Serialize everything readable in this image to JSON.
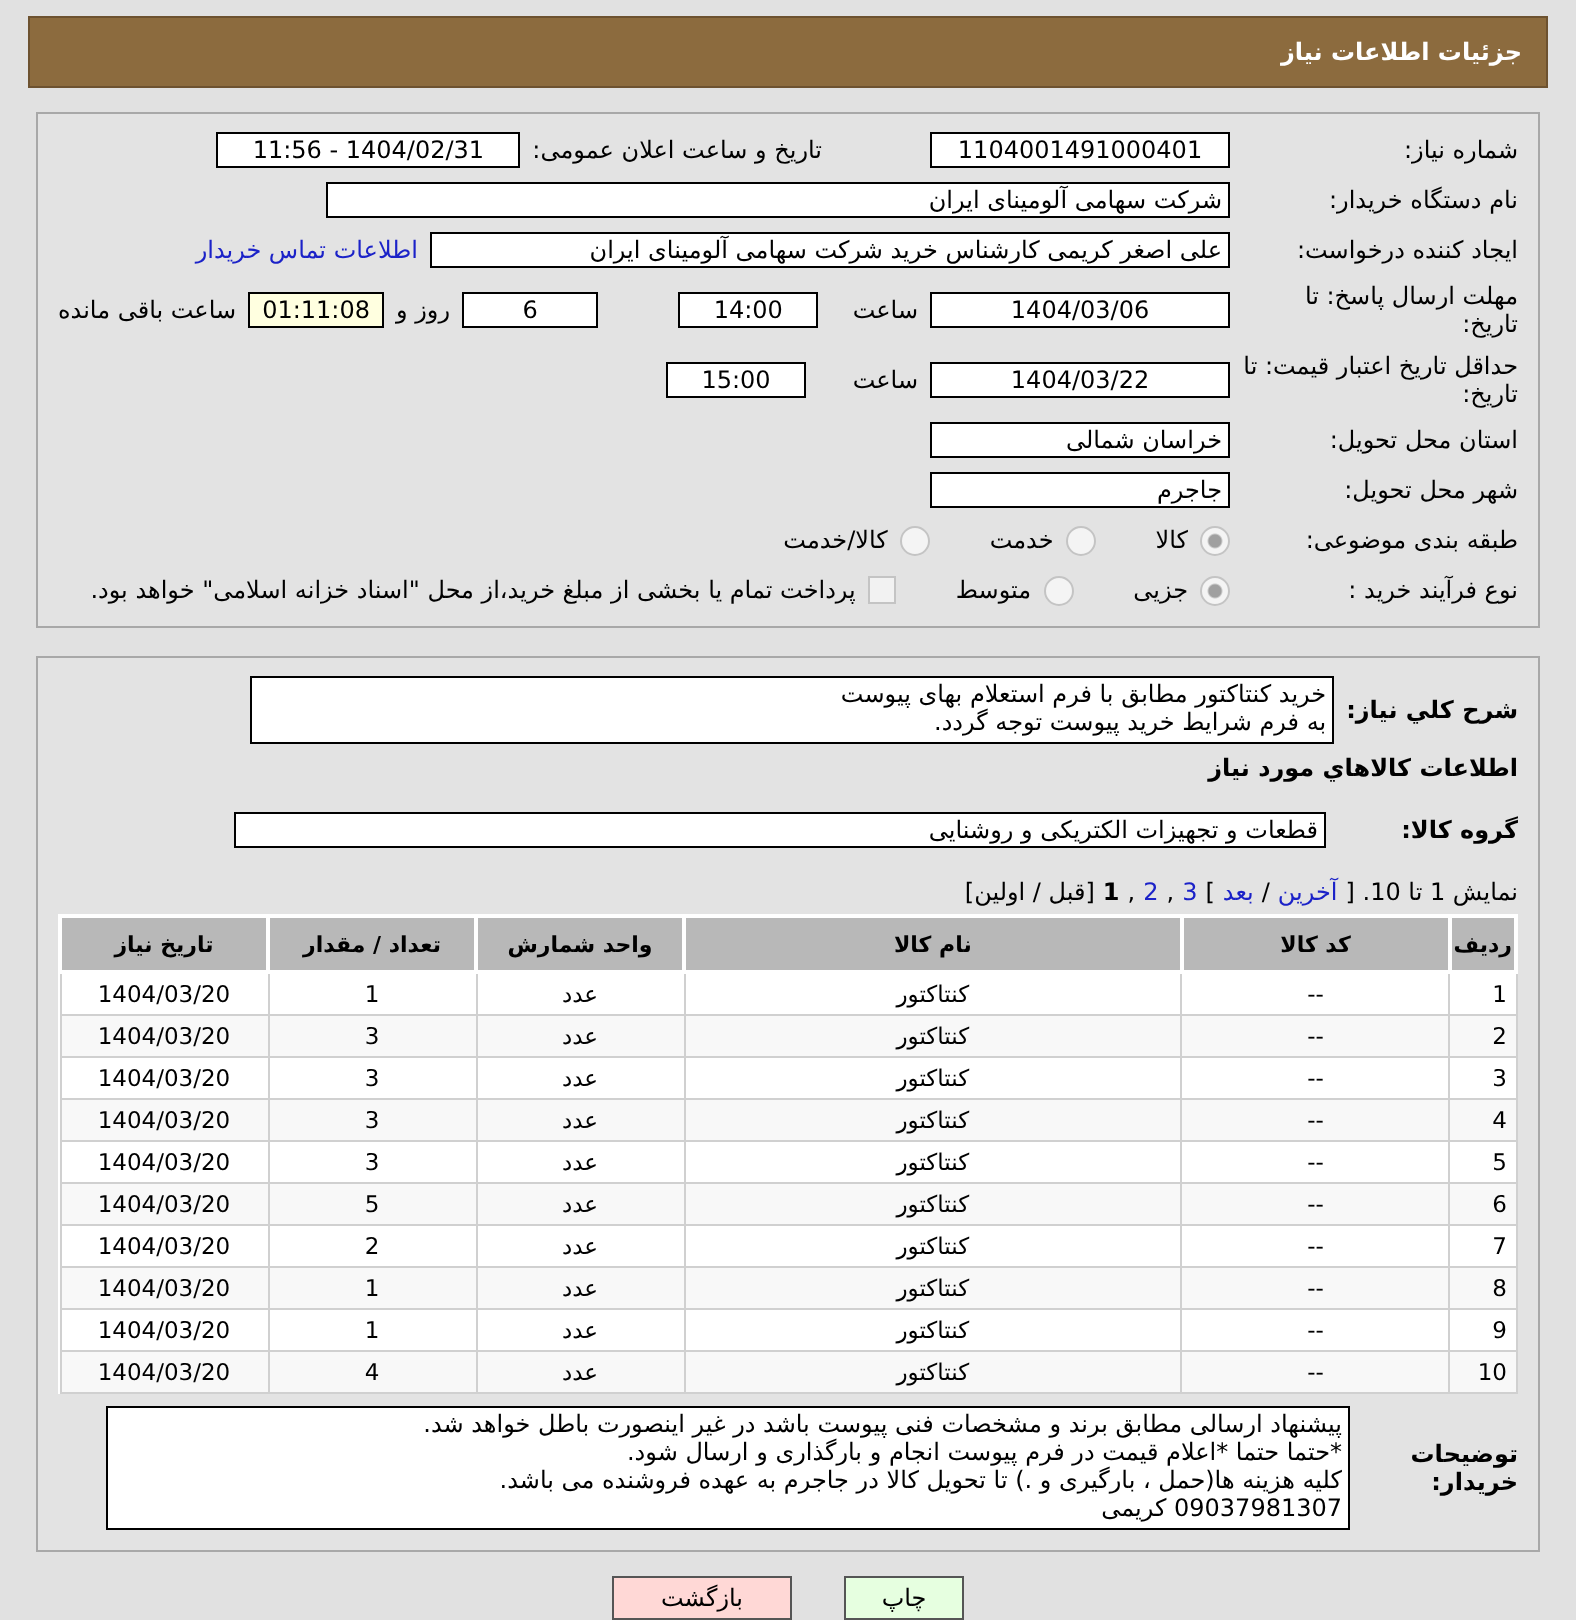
{
  "header": {
    "title": "جزئیات اطلاعات نیاز"
  },
  "need_number": {
    "label": "شماره نیاز:",
    "value": "1104001491000401"
  },
  "announce": {
    "label": "تاریخ و ساعت اعلان عمومی:",
    "value": "1404/02/31 - 11:56"
  },
  "buyer_org": {
    "label": "نام دستگاه خریدار:",
    "value": "شرکت سهامی آلومینای ایران"
  },
  "creator": {
    "label": "ایجاد کننده درخواست:",
    "value": "علی اصغر کریمی کارشناس خرید شرکت سهامی آلومینای ایران",
    "link": "اطلاعات تماس خریدار"
  },
  "deadline": {
    "label": "مهلت ارسال پاسخ: تا تاریخ:",
    "date": "1404/03/06",
    "time_label": "ساعت",
    "time": "14:00",
    "days": "6",
    "days_label": "روز و",
    "remaining": "01:11:08",
    "remaining_label": "ساعت باقی مانده"
  },
  "validity": {
    "label": "حداقل تاریخ اعتبار قیمت: تا تاریخ:",
    "date": "1404/03/22",
    "time_label": "ساعت",
    "time": "15:00"
  },
  "province": {
    "label": "استان محل تحویل:",
    "value": "خراسان شمالی"
  },
  "city": {
    "label": "شهر محل تحویل:",
    "value": "جاجرم"
  },
  "category": {
    "label": "طبقه بندی موضوعی:",
    "options": [
      {
        "label": "کالا",
        "selected": true
      },
      {
        "label": "خدمت",
        "selected": false
      },
      {
        "label": "کالا/خدمت",
        "selected": false
      }
    ]
  },
  "process": {
    "label": "نوع فرآیند خرید :",
    "options": [
      {
        "label": "جزیی",
        "selected": true
      },
      {
        "label": "متوسط",
        "selected": false
      }
    ],
    "payment": {
      "label": "پرداخت تمام یا بخشی از مبلغ خرید،از محل \"اسناد خزانه اسلامی\" خواهد بود.",
      "checked": false
    }
  },
  "description": {
    "label": "شرح کلي نياز:",
    "value": "خرید کنتاکتور مطابق با فرم استعلام بهای پیوست\nبه فرم شرایط خرید پیوست توجه گردد."
  },
  "goods_title": "اطلاعات کالاهاي مورد نياز",
  "goods_group": {
    "label": "گروه کالا:",
    "value": "قطعات و تجهیزات الکتریکی و روشنایی"
  },
  "pagination": [
    {
      "kind": "text",
      "text": "نمایش 1 تا 10. ["
    },
    {
      "kind": "link",
      "text": "آخرین"
    },
    {
      "kind": "text",
      "text": "/"
    },
    {
      "kind": "link",
      "text": "بعد"
    },
    {
      "kind": "text",
      "text": "]"
    },
    {
      "kind": "link",
      "text": "3"
    },
    {
      "kind": "text",
      "text": ","
    },
    {
      "kind": "link",
      "text": "2"
    },
    {
      "kind": "text",
      "text": ","
    },
    {
      "kind": "current",
      "text": "1"
    },
    {
      "kind": "text",
      "text": "[قبل / اولین]"
    }
  ],
  "table": {
    "columns": [
      "ردیف",
      "کد کالا",
      "نام کالا",
      "واحد شمارش",
      "تعداد / مقدار",
      "تاریخ نیاز"
    ],
    "rows": [
      [
        "1",
        "--",
        "کنتاکتور",
        "عدد",
        "1",
        "1404/03/20"
      ],
      [
        "2",
        "--",
        "کنتاکتور",
        "عدد",
        "3",
        "1404/03/20"
      ],
      [
        "3",
        "--",
        "کنتاکتور",
        "عدد",
        "3",
        "1404/03/20"
      ],
      [
        "4",
        "--",
        "کنتاکتور",
        "عدد",
        "3",
        "1404/03/20"
      ],
      [
        "5",
        "--",
        "کنتاکتور",
        "عدد",
        "3",
        "1404/03/20"
      ],
      [
        "6",
        "--",
        "کنتاکتور",
        "عدد",
        "5",
        "1404/03/20"
      ],
      [
        "7",
        "--",
        "کنتاکتور",
        "عدد",
        "2",
        "1404/03/20"
      ],
      [
        "8",
        "--",
        "کنتاکتور",
        "عدد",
        "1",
        "1404/03/20"
      ],
      [
        "9",
        "--",
        "کنتاکتور",
        "عدد",
        "1",
        "1404/03/20"
      ],
      [
        "10",
        "--",
        "کنتاکتور",
        "عدد",
        "4",
        "1404/03/20"
      ]
    ]
  },
  "notes": {
    "label": "توضیحات خریدار:",
    "value": "پیشنهاد ارسالی مطابق برند و مشخصات فنی پیوست باشد در غیر اینصورت باطل خواهد شد.\n*حتما حتما *اعلام قیمت در فرم پیوست انجام و بارگذاری و ارسال شود.\nکلیه هزینه ها(حمل ، بارگیری و .) تا تحویل کالا در جاجرم به عهده فروشنده می باشد.\n09037981307 کریمی"
  },
  "buttons": [
    {
      "kind": "print",
      "label": "چاپ"
    },
    {
      "kind": "back",
      "label": "بازگشت"
    }
  ]
}
